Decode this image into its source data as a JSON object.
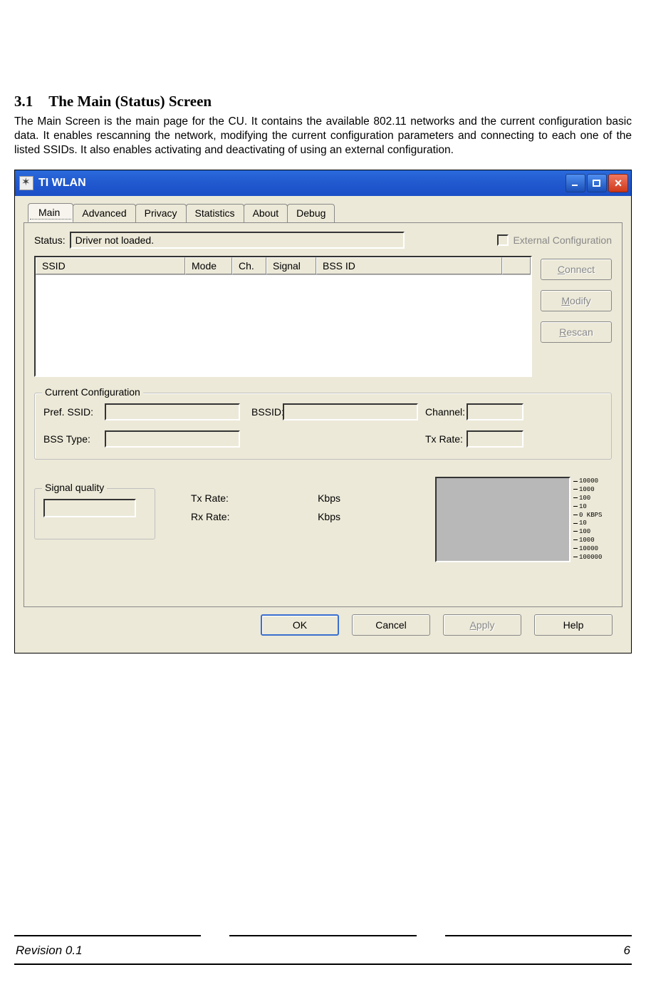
{
  "doc": {
    "heading_num": "3.1",
    "heading_text": "The Main (Status) Screen",
    "paragraph": "The Main Screen is the main page for the CU. It contains the available 802.11 networks and the current configuration basic data. It enables rescanning the network, modifying the current configuration parameters and connecting to each one of the listed SSIDs. It also enables activating and deactivating of using an external configuration.",
    "footer_left": "Revision 0.1",
    "footer_right": "6"
  },
  "window": {
    "title": "TI WLAN",
    "tabs": [
      "Main",
      "Advanced",
      "Privacy",
      "Statistics",
      "About",
      "Debug"
    ],
    "status_label": "Status:",
    "status_value": "Driver not loaded.",
    "ext_cfg_label": "External Configuration",
    "list_headers": {
      "ssid": "SSID",
      "mode": "Mode",
      "ch": "Ch.",
      "signal": "Signal",
      "bssid": "BSS ID"
    },
    "buttons": {
      "connect": "onnect",
      "modify": "odify",
      "rescan": "escan",
      "connect_u": "C",
      "modify_u": "M",
      "rescan_u": "R"
    },
    "current_cfg": {
      "legend": "Current Configuration",
      "pref_ssid": "Pref. SSID:",
      "bssid": "BSSID:",
      "channel": "Channel:",
      "bss_type": "BSS Type:",
      "tx_rate": "Tx Rate:"
    },
    "signal_quality_legend": "Signal quality",
    "rates": {
      "tx_label": "Tx Rate:",
      "rx_label": "Rx Rate:",
      "unit": "Kbps"
    },
    "scale": [
      "10000",
      "1000",
      "100",
      "10",
      "0  KBPS",
      "10",
      "100",
      "1000",
      "10000",
      "100000"
    ],
    "dialog_buttons": {
      "ok": "OK",
      "cancel": "Cancel",
      "apply": "pply",
      "apply_u": "A",
      "help": "Help"
    }
  }
}
